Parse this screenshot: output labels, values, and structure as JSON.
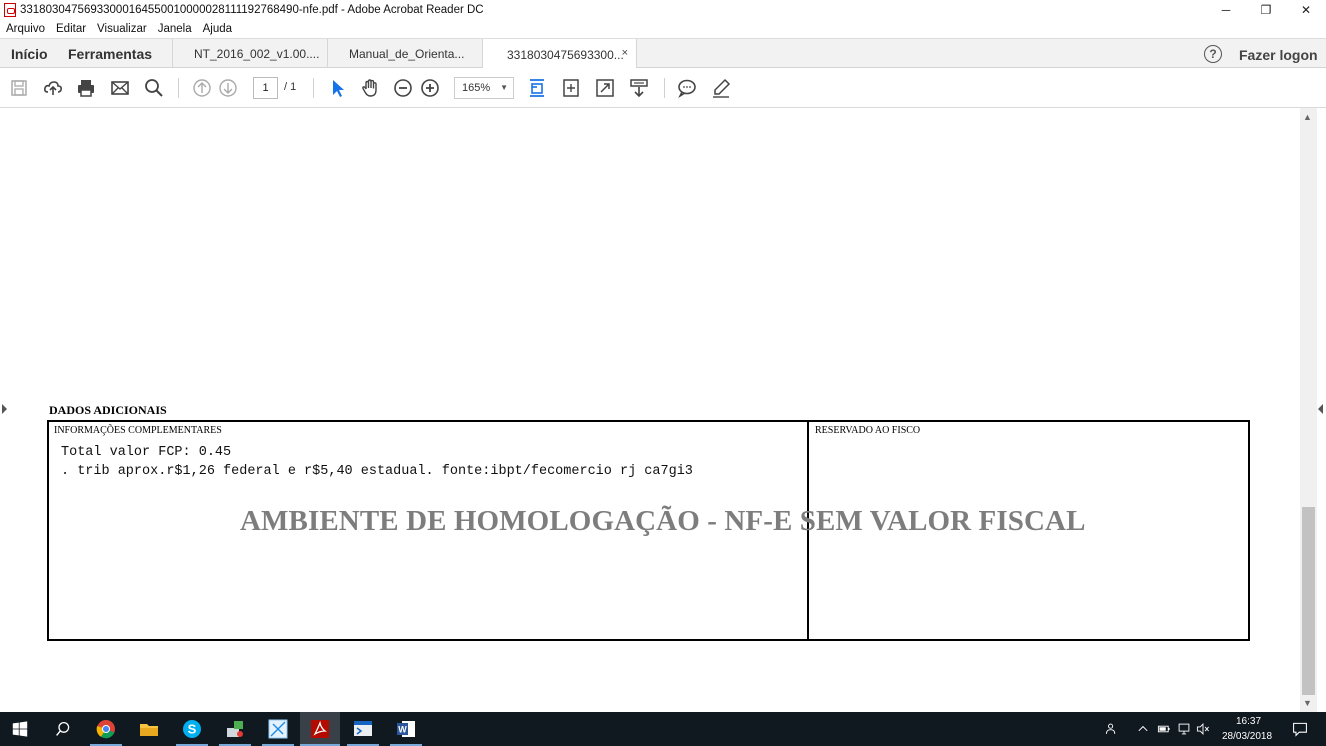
{
  "window": {
    "title": "33180304756933000164550010000028111192768490-nfe.pdf - Adobe Acrobat Reader DC",
    "minimize": "─",
    "maximize": "❐",
    "close": "✕"
  },
  "menu": {
    "items": [
      "Arquivo",
      "Editar",
      "Visualizar",
      "Janela",
      "Ajuda"
    ]
  },
  "tabs": {
    "home": "Início",
    "tools": "Ferramentas",
    "documents": [
      {
        "label": "NT_2016_002_v1.00...."
      },
      {
        "label": "Manual_de_Orienta..."
      },
      {
        "label": "3318030475693300...",
        "close": "×",
        "active": true
      }
    ],
    "help": "?",
    "logon": "Fazer logon"
  },
  "toolbar": {
    "page_current": "1",
    "page_total": "/  1",
    "zoom": "165%",
    "zoom_caret": "▼"
  },
  "document": {
    "section_title": "DADOS ADICIONAIS",
    "left_label": "INFORMAÇÕES COMPLEMENTARES",
    "right_label": "RESERVADO AO FISCO",
    "lines": [
      "Total valor FCP: 0.45",
      ". trib aprox.r$1,26 federal e r$5,40 estadual. fonte:ibpt/fecomercio rj ca7gi3"
    ],
    "watermark": "AMBIENTE DE HOMOLOGAÇÃO - NF-E SEM VALOR FISCAL"
  },
  "taskbar": {
    "time": "16:37",
    "date": "28/03/2018"
  },
  "colors": {
    "acrobat_red": "#d9251d",
    "tool_blue": "#1473e6",
    "taskbar": "#101820"
  }
}
